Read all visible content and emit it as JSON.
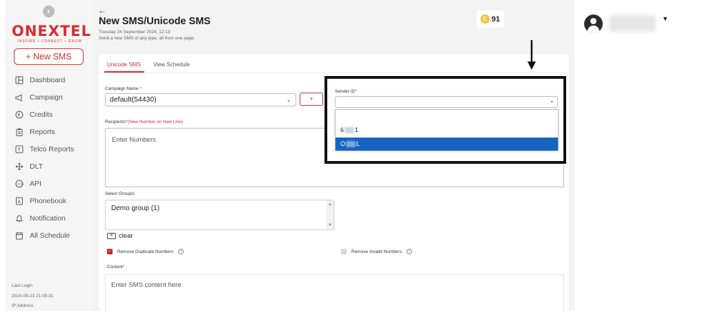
{
  "sidebar": {
    "logo_text": "ONEXTEL",
    "logo_tagline": "INSPIRE • CONNECT • GROW",
    "new_sms_label": "+ New SMS",
    "items": [
      {
        "label": "Dashboard",
        "icon": "dashboard-icon"
      },
      {
        "label": "Campaign",
        "icon": "megaphone-icon"
      },
      {
        "label": "Credits",
        "icon": "coin-icon"
      },
      {
        "label": "Reports",
        "icon": "clipboard-icon"
      },
      {
        "label": "Telco Reports",
        "icon": "telco-icon"
      },
      {
        "label": "DLT",
        "icon": "move-icon"
      },
      {
        "label": "API",
        "icon": "api-icon"
      },
      {
        "label": "Phonebook",
        "icon": "phonebook-icon"
      },
      {
        "label": "Notification",
        "icon": "bell-icon"
      },
      {
        "label": "All Schedule",
        "icon": "calendar-icon"
      }
    ],
    "last_login_label": "Last Login",
    "last_login_value": "2024-09-23 21:09:31",
    "ip_label": "IP Address"
  },
  "header": {
    "back_label": "←",
    "title": "New SMS/Unicode SMS",
    "date": "Tuesday 24 September 2024, 12:13",
    "subtitle": "Send a new SMS of any type, all from one page.",
    "credits_value": "91"
  },
  "tabs": [
    {
      "label": "Unicode SMS",
      "active": true
    },
    {
      "label": "View Schedule",
      "active": false
    }
  ],
  "form": {
    "campaign_label": "Campaign Name",
    "campaign_value": "default(54430)",
    "plus_label": "+",
    "sender_label": "Sender ID",
    "sender_value": "",
    "sender_options": [
      {
        "prefix": "6",
        "suffix": "1",
        "selected": false
      },
      {
        "prefix": "O",
        "suffix": "L",
        "selected": true
      }
    ],
    "recipients_label": "Recipients",
    "recipients_note": "(New Number on New Line)",
    "recipients_placeholder": "Enter Numbers",
    "groups_label": "Select Group/s",
    "groups_value": "Demo group (1)",
    "clear_label": "clear",
    "remove_duplicates_label": "Remove Duplicate Numbers",
    "remove_duplicates_checked": true,
    "remove_invalid_label": "Remove Invalid Numbers",
    "remove_invalid_checked": true,
    "content_label": "Content",
    "content_placeholder": "Enter SMS content here"
  },
  "colors": {
    "brand": "#d32f2f",
    "selected_option": "#1565c0",
    "coin": "#f2c230"
  }
}
